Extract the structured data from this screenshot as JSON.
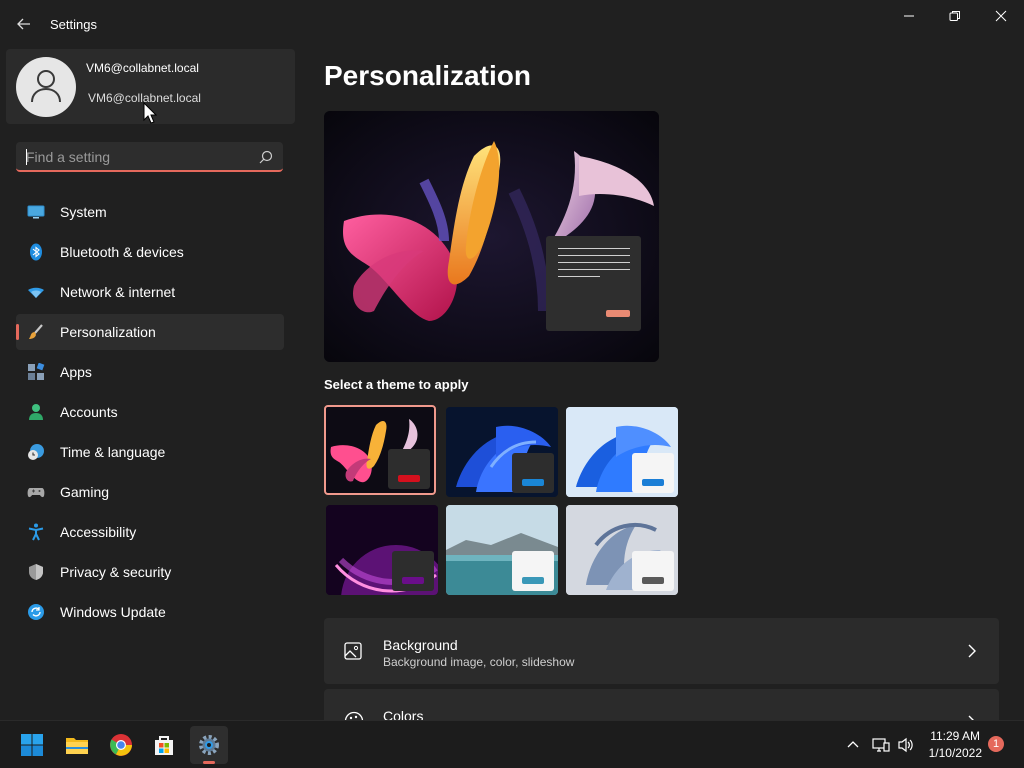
{
  "app": {
    "title": "Settings",
    "accent": "#e5695c"
  },
  "window_controls": {
    "minimize": "minimize-icon",
    "maximize": "restore-icon",
    "close": "close-icon"
  },
  "profile": {
    "line1": "VM6@collabnet.local",
    "line2": "VM6@collabnet.local"
  },
  "search": {
    "placeholder": "Find a setting",
    "value": ""
  },
  "nav": {
    "items": [
      {
        "label": "System",
        "icon": "system-icon"
      },
      {
        "label": "Bluetooth & devices",
        "icon": "bluetooth-icon"
      },
      {
        "label": "Network & internet",
        "icon": "wifi-icon"
      },
      {
        "label": "Personalization",
        "icon": "brush-icon",
        "active": true
      },
      {
        "label": "Apps",
        "icon": "apps-icon"
      },
      {
        "label": "Accounts",
        "icon": "accounts-icon"
      },
      {
        "label": "Time & language",
        "icon": "clock-globe-icon"
      },
      {
        "label": "Gaming",
        "icon": "gamepad-icon"
      },
      {
        "label": "Accessibility",
        "icon": "accessibility-icon"
      },
      {
        "label": "Privacy & security",
        "icon": "shield-icon"
      },
      {
        "label": "Windows Update",
        "icon": "update-icon"
      }
    ]
  },
  "main": {
    "title": "Personalization",
    "themes_label": "Select a theme to apply",
    "themes": [
      {
        "name": "glow-dark",
        "selected": true,
        "button_color": "#d4101d"
      },
      {
        "name": "bloom-dark",
        "button_color": "#1a86d6"
      },
      {
        "name": "bloom-light",
        "button_color": "#1a7ed6"
      },
      {
        "name": "captured-motion",
        "button_color": "#6a0e8a"
      },
      {
        "name": "sunrise",
        "button_color": "#3a98b8"
      },
      {
        "name": "flow",
        "button_color": "#5a5a5a"
      }
    ],
    "cards": [
      {
        "title": "Background",
        "subtitle": "Background image, color, slideshow",
        "icon": "picture-icon"
      },
      {
        "title": "Colors",
        "subtitle": "",
        "icon": "palette-icon"
      }
    ]
  },
  "taskbar": {
    "apps": [
      "start-icon",
      "file-explorer-icon",
      "chrome-icon",
      "store-icon",
      "settings-gear-icon"
    ],
    "clock": {
      "time": "11:29 AM",
      "date": "1/10/2022"
    },
    "notifications": "1"
  }
}
